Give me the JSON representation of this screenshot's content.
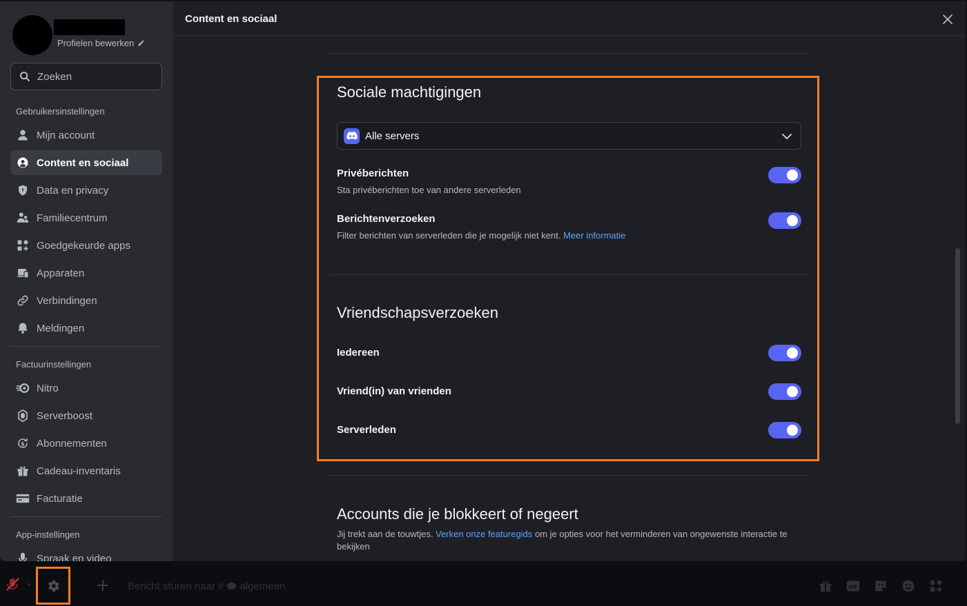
{
  "sidebar": {
    "edit_profiles": "Profielen bewerken",
    "search_placeholder": "Zoeken",
    "user_settings_header": "Gebruikersinstellingen",
    "user_items": [
      {
        "label": "Mijn account",
        "icon": "person-icon"
      },
      {
        "label": "Content en sociaal",
        "icon": "content-social-icon",
        "active": true
      },
      {
        "label": "Data en privacy",
        "icon": "shield-icon"
      },
      {
        "label": "Familiecentrum",
        "icon": "family-icon"
      },
      {
        "label": "Goedgekeurde apps",
        "icon": "apps-icon"
      },
      {
        "label": "Apparaten",
        "icon": "devices-icon"
      },
      {
        "label": "Verbindingen",
        "icon": "link-icon"
      },
      {
        "label": "Meldingen",
        "icon": "bell-icon"
      }
    ],
    "billing_header": "Factuurinstellingen",
    "billing_items": [
      {
        "label": "Nitro",
        "icon": "nitro-icon"
      },
      {
        "label": "Serverboost",
        "icon": "boost-icon"
      },
      {
        "label": "Abonnementen",
        "icon": "subscriptions-icon"
      },
      {
        "label": "Cadeau-inventaris",
        "icon": "gift-icon"
      },
      {
        "label": "Facturatie",
        "icon": "card-icon"
      }
    ],
    "app_header": "App-instellingen",
    "app_items": [
      {
        "label": "Spraak en video",
        "icon": "mic-icon"
      }
    ]
  },
  "content": {
    "title": "Content en sociaal",
    "social": {
      "heading": "Sociale machtigingen",
      "dropdown_value": "Alle servers",
      "dm_title": "Privéberichten",
      "dm_sub": "Sta privéberichten toe van andere serverleden",
      "dm_on": true,
      "requests_title": "Berichtenverzoeken",
      "requests_sub": "Filter berichten van serverleden die je mogelijk niet kent.",
      "requests_link": "Meer informatie",
      "requests_on": true
    },
    "friends": {
      "heading": "Vriendschapsverzoeken",
      "everyone": "Iedereen",
      "everyone_on": true,
      "fof": "Vriend(in) van vrienden",
      "fof_on": true,
      "server_members": "Serverleden",
      "server_members_on": true
    },
    "accounts": {
      "heading": "Accounts die je blokkeert of negeert",
      "sub_before": "Jij trekt aan de touwtjes.",
      "sub_link": "Verken onze featuregids",
      "sub_after": "om je opties voor het verminderen van ongewenste interactie te bekijken"
    }
  },
  "bottom": {
    "message_prefix": "Bericht sturen naar #",
    "channel": "algemeen"
  },
  "colors": {
    "accent": "#5865f2",
    "highlight": "#f77f24",
    "link": "#5ea4f5"
  }
}
